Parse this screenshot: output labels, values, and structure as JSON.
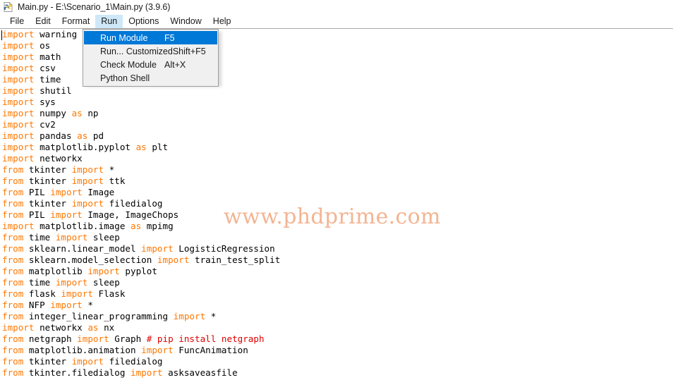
{
  "window": {
    "icon": "python-idle-icon",
    "title": "Main.py - E:\\Scenario_1\\Main.py (3.9.6)"
  },
  "menubar": {
    "items": [
      {
        "label": "File",
        "open": false
      },
      {
        "label": "Edit",
        "open": false
      },
      {
        "label": "Format",
        "open": false
      },
      {
        "label": "Run",
        "open": true
      },
      {
        "label": "Options",
        "open": false
      },
      {
        "label": "Window",
        "open": false
      },
      {
        "label": "Help",
        "open": false
      }
    ]
  },
  "run_menu": {
    "items": [
      {
        "label": "Run Module",
        "accel": "F5",
        "selected": true
      },
      {
        "label": "Run... Customized",
        "accel": "Shift+F5",
        "selected": false
      },
      {
        "label": "Check Module",
        "accel": "Alt+X",
        "selected": false
      },
      {
        "label": "Python Shell",
        "accel": "",
        "selected": false
      }
    ]
  },
  "watermark": {
    "text": "www.phdprime.com",
    "color": "#f3b492"
  },
  "editor": {
    "syntax_colors": {
      "keyword": "#ff7700",
      "identifier": "#000000",
      "comment": "#dd0000"
    },
    "lines": [
      [
        [
          "kw",
          "import"
        ],
        [
          "id",
          " warning"
        ]
      ],
      [
        [
          "kw",
          "import"
        ],
        [
          "id",
          " os"
        ]
      ],
      [
        [
          "kw",
          "import"
        ],
        [
          "id",
          " math"
        ]
      ],
      [
        [
          "kw",
          "import"
        ],
        [
          "id",
          " csv"
        ]
      ],
      [
        [
          "kw",
          "import"
        ],
        [
          "id",
          " time"
        ]
      ],
      [
        [
          "kw",
          "import"
        ],
        [
          "id",
          " shutil"
        ]
      ],
      [
        [
          "kw",
          "import"
        ],
        [
          "id",
          " sys"
        ]
      ],
      [
        [
          "kw",
          "import"
        ],
        [
          "id",
          " numpy "
        ],
        [
          "kw",
          "as"
        ],
        [
          "id",
          " np"
        ]
      ],
      [
        [
          "kw",
          "import"
        ],
        [
          "id",
          " cv2"
        ]
      ],
      [
        [
          "kw",
          "import"
        ],
        [
          "id",
          " pandas "
        ],
        [
          "kw",
          "as"
        ],
        [
          "id",
          " pd"
        ]
      ],
      [
        [
          "kw",
          "import"
        ],
        [
          "id",
          " matplotlib.pyplot "
        ],
        [
          "kw",
          "as"
        ],
        [
          "id",
          " plt"
        ]
      ],
      [
        [
          "kw",
          "import"
        ],
        [
          "id",
          " networkx"
        ]
      ],
      [
        [
          "kw",
          "from"
        ],
        [
          "id",
          " tkinter "
        ],
        [
          "kw",
          "import"
        ],
        [
          "id",
          " *"
        ]
      ],
      [
        [
          "kw",
          "from"
        ],
        [
          "id",
          " tkinter "
        ],
        [
          "kw",
          "import"
        ],
        [
          "id",
          " ttk"
        ]
      ],
      [
        [
          "kw",
          "from"
        ],
        [
          "id",
          " PIL "
        ],
        [
          "kw",
          "import"
        ],
        [
          "id",
          " Image"
        ]
      ],
      [
        [
          "kw",
          "from"
        ],
        [
          "id",
          " tkinter "
        ],
        [
          "kw",
          "import"
        ],
        [
          "id",
          " filedialog"
        ]
      ],
      [
        [
          "kw",
          "from"
        ],
        [
          "id",
          " PIL "
        ],
        [
          "kw",
          "import"
        ],
        [
          "id",
          " Image, ImageChops"
        ]
      ],
      [
        [
          "kw",
          "import"
        ],
        [
          "id",
          " matplotlib.image "
        ],
        [
          "kw",
          "as"
        ],
        [
          "id",
          " mpimg"
        ]
      ],
      [
        [
          "kw",
          "from"
        ],
        [
          "id",
          " time "
        ],
        [
          "kw",
          "import"
        ],
        [
          "id",
          " sleep"
        ]
      ],
      [
        [
          "kw",
          "from"
        ],
        [
          "id",
          " sklearn.linear_model "
        ],
        [
          "kw",
          "import"
        ],
        [
          "id",
          " LogisticRegression"
        ]
      ],
      [
        [
          "kw",
          "from"
        ],
        [
          "id",
          " sklearn.model_selection "
        ],
        [
          "kw",
          "import"
        ],
        [
          "id",
          " train_test_split"
        ]
      ],
      [
        [
          "kw",
          "from"
        ],
        [
          "id",
          " matplotlib "
        ],
        [
          "kw",
          "import"
        ],
        [
          "id",
          " pyplot"
        ]
      ],
      [
        [
          "kw",
          "from"
        ],
        [
          "id",
          " time "
        ],
        [
          "kw",
          "import"
        ],
        [
          "id",
          " sleep"
        ]
      ],
      [
        [
          "kw",
          "from"
        ],
        [
          "id",
          " flask "
        ],
        [
          "kw",
          "import"
        ],
        [
          "id",
          " Flask"
        ]
      ],
      [
        [
          "kw",
          "from"
        ],
        [
          "id",
          " NFP "
        ],
        [
          "kw",
          "import"
        ],
        [
          "id",
          " *"
        ]
      ],
      [
        [
          "kw",
          "from"
        ],
        [
          "id",
          " integer_linear_programming "
        ],
        [
          "kw",
          "import"
        ],
        [
          "id",
          " *"
        ]
      ],
      [
        [
          "kw",
          "import"
        ],
        [
          "id",
          " networkx "
        ],
        [
          "kw",
          "as"
        ],
        [
          "id",
          " nx"
        ]
      ],
      [
        [
          "kw",
          "from"
        ],
        [
          "id",
          " netgraph "
        ],
        [
          "kw",
          "import"
        ],
        [
          "id",
          " Graph "
        ],
        [
          "cm",
          "# pip install netgraph"
        ]
      ],
      [
        [
          "kw",
          "from"
        ],
        [
          "id",
          " matplotlib.animation "
        ],
        [
          "kw",
          "import"
        ],
        [
          "id",
          " FuncAnimation"
        ]
      ],
      [
        [
          "kw",
          "from"
        ],
        [
          "id",
          " tkinter "
        ],
        [
          "kw",
          "import"
        ],
        [
          "id",
          " filedialog"
        ]
      ],
      [
        [
          "kw",
          "from"
        ],
        [
          "id",
          " tkinter.filedialog "
        ],
        [
          "kw",
          "import"
        ],
        [
          "id",
          " asksaveasfile"
        ]
      ]
    ]
  }
}
